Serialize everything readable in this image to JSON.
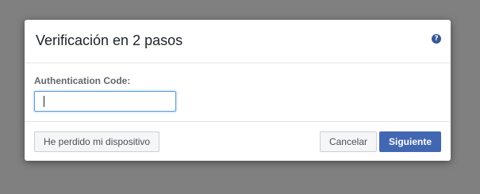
{
  "dialog": {
    "title": "Verificación en 2 pasos",
    "help_icon": "help-icon",
    "help_glyph": "?"
  },
  "form": {
    "code_label": "Authentication Code:",
    "code_value": "",
    "code_placeholder": ""
  },
  "footer": {
    "lost_device_label": "He perdido mi dispositivo",
    "cancel_label": "Cancelar",
    "next_label": "Siguiente"
  },
  "colors": {
    "primary": "#4267b2",
    "overlay": "#808080",
    "focus_border": "#5b9dd9"
  }
}
